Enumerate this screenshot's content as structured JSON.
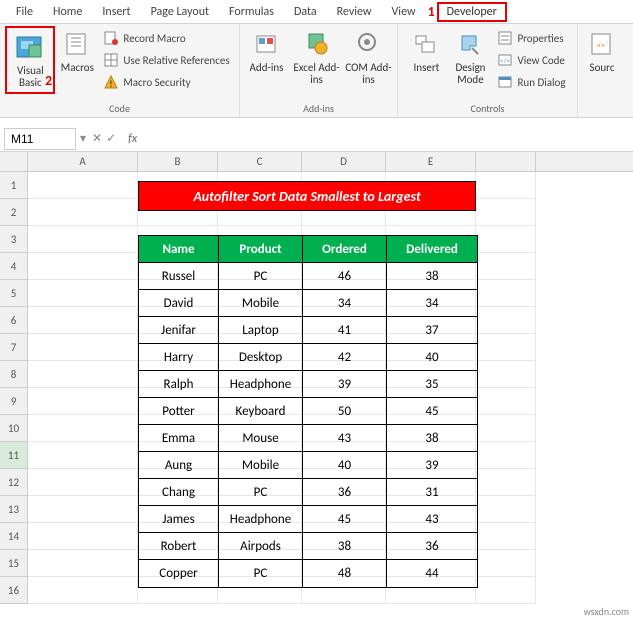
{
  "tabs": {
    "file": "File",
    "home": "Home",
    "insert": "Insert",
    "pagelayout": "Page Layout",
    "formulas": "Formulas",
    "data": "Data",
    "review": "Review",
    "view": "View",
    "developer": "Developer"
  },
  "callouts": {
    "one": "1",
    "two": "2"
  },
  "ribbon": {
    "code": {
      "visualbasic": "Visual Basic",
      "macros": "Macros",
      "record": "Record Macro",
      "relative": "Use Relative References",
      "security": "Macro Security",
      "label": "Code"
    },
    "addins": {
      "addins": "Add-ins",
      "excel": "Excel Add-ins",
      "com": "COM Add-ins",
      "label": "Add-ins"
    },
    "controls": {
      "insert": "Insert",
      "design": "Design Mode",
      "props": "Properties",
      "viewcode": "View Code",
      "rundialog": "Run Dialog",
      "label": "Controls"
    },
    "source": {
      "source": "Sourc"
    }
  },
  "namebox": "M11",
  "fx": "fx",
  "columns": [
    "A",
    "B",
    "C",
    "D",
    "E"
  ],
  "rows": [
    "1",
    "2",
    "3",
    "4",
    "5",
    "6",
    "7",
    "8",
    "9",
    "10",
    "11",
    "12",
    "13",
    "14",
    "15",
    "16"
  ],
  "banner": "Autofilter Sort Data Smallest to Largest",
  "table": {
    "headers": [
      "Name",
      "Product",
      "Ordered",
      "Delivered"
    ],
    "rows": [
      [
        "Russel",
        "PC",
        "46",
        "38"
      ],
      [
        "David",
        "Mobile",
        "34",
        "34"
      ],
      [
        "Jenifar",
        "Laptop",
        "41",
        "37"
      ],
      [
        "Harry",
        "Desktop",
        "42",
        "40"
      ],
      [
        "Ralph",
        "Headphone",
        "39",
        "35"
      ],
      [
        "Potter",
        "Keyboard",
        "50",
        "45"
      ],
      [
        "Emma",
        "Mouse",
        "43",
        "38"
      ],
      [
        "Aung",
        "Mobile",
        "40",
        "39"
      ],
      [
        "Chang",
        "PC",
        "36",
        "31"
      ],
      [
        "James",
        "Headphone",
        "45",
        "43"
      ],
      [
        "Robert",
        "Airpods",
        "38",
        "36"
      ],
      [
        "Copper",
        "PC",
        "48",
        "44"
      ]
    ]
  },
  "watermark": "wsxdn.com"
}
